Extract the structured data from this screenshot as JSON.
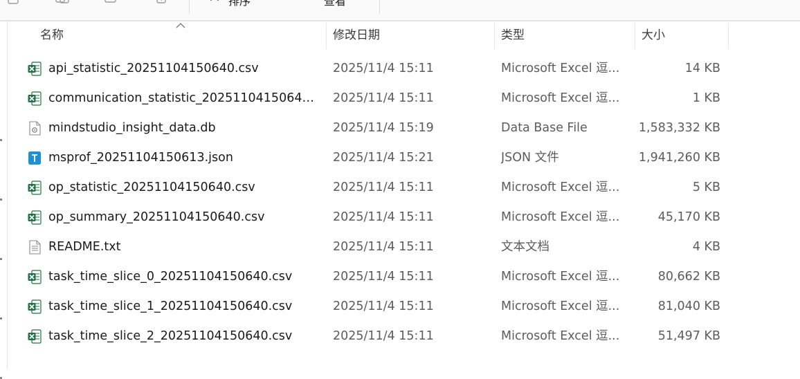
{
  "toolbar": {
    "sort_label": "排序",
    "view_label": "查看"
  },
  "columns": {
    "name": "名称",
    "date": "修改日期",
    "type": "类型",
    "size": "大小"
  },
  "files": [
    {
      "name": "api_statistic_20251104150640.csv",
      "date": "2025/11/4 15:11",
      "type": "Microsoft Excel 逗...",
      "size": "14 KB",
      "icon": "excel-csv-icon"
    },
    {
      "name": "communication_statistic_20251104150640....",
      "date": "2025/11/4 15:11",
      "type": "Microsoft Excel 逗...",
      "size": "1 KB",
      "icon": "excel-csv-icon"
    },
    {
      "name": "mindstudio_insight_data.db",
      "date": "2025/11/4 15:19",
      "type": "Data Base File",
      "size": "1,583,332 KB",
      "icon": "database-file-icon"
    },
    {
      "name": "msprof_20251104150613.json",
      "date": "2025/11/4 15:21",
      "type": "JSON 文件",
      "size": "1,941,260 KB",
      "icon": "json-file-icon"
    },
    {
      "name": "op_statistic_20251104150640.csv",
      "date": "2025/11/4 15:11",
      "type": "Microsoft Excel 逗...",
      "size": "5 KB",
      "icon": "excel-csv-icon"
    },
    {
      "name": "op_summary_20251104150640.csv",
      "date": "2025/11/4 15:11",
      "type": "Microsoft Excel 逗...",
      "size": "45,170 KB",
      "icon": "excel-csv-icon"
    },
    {
      "name": "README.txt",
      "date": "2025/11/4 15:11",
      "type": "文本文档",
      "size": "4 KB",
      "icon": "text-file-icon"
    },
    {
      "name": "task_time_slice_0_20251104150640.csv",
      "date": "2025/11/4 15:11",
      "type": "Microsoft Excel 逗...",
      "size": "80,662 KB",
      "icon": "excel-csv-icon"
    },
    {
      "name": "task_time_slice_1_20251104150640.csv",
      "date": "2025/11/4 15:11",
      "type": "Microsoft Excel 逗...",
      "size": "81,040 KB",
      "icon": "excel-csv-icon"
    },
    {
      "name": "task_time_slice_2_20251104150640.csv",
      "date": "2025/11/4 15:11",
      "type": "Microsoft Excel 逗...",
      "size": "51,497 KB",
      "icon": "excel-csv-icon"
    }
  ],
  "colors": {
    "excel_green": "#1f7244",
    "json_blue": "#1e90d6",
    "header_text": "#3b3b3b",
    "secondary_text": "#5c5c5c"
  }
}
